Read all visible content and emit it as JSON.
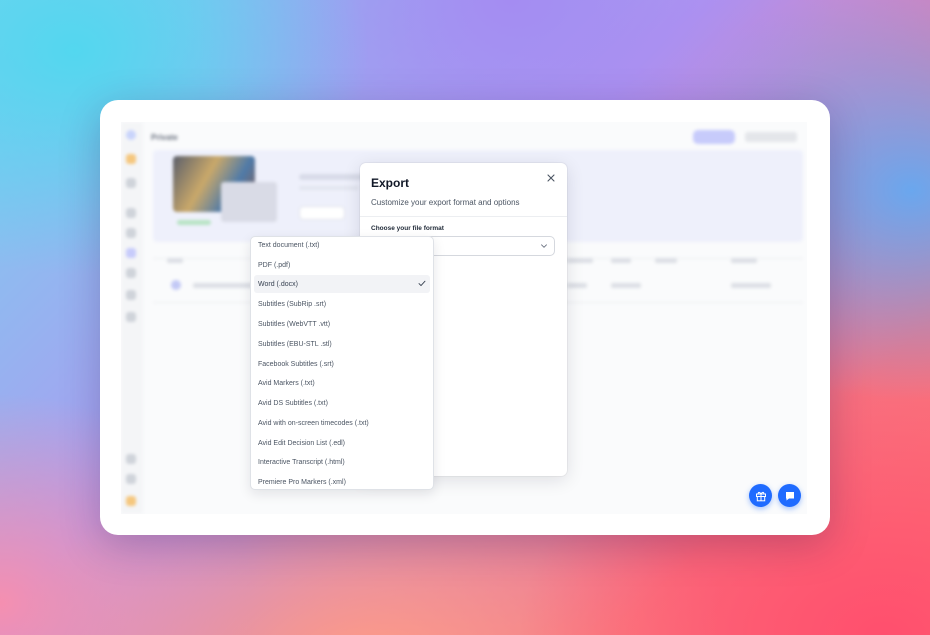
{
  "background_app": {
    "page_title": "Private"
  },
  "export_modal": {
    "title": "Export",
    "subtitle": "Customize your export format and options",
    "format_label": "Choose your file format",
    "selected_format": "Word (.docx)",
    "close_icon": "close-icon",
    "options": [
      {
        "label": "Text document (.txt)",
        "selected": false
      },
      {
        "label": "PDF (.pdf)",
        "selected": false
      },
      {
        "label": "Word (.docx)",
        "selected": true
      },
      {
        "label": "Subtitles (SubRip .srt)",
        "selected": false
      },
      {
        "label": "Subtitles (WebVTT .vtt)",
        "selected": false
      },
      {
        "label": "Subtitles (EBU-STL .stl)",
        "selected": false
      },
      {
        "label": "Facebook Subtitles (.srt)",
        "selected": false
      },
      {
        "label": "Avid Markers (.txt)",
        "selected": false
      },
      {
        "label": "Avid DS Subtitles (.txt)",
        "selected": false
      },
      {
        "label": "Avid with on-screen timecodes (.txt)",
        "selected": false
      },
      {
        "label": "Avid Edit Decision List (.edl)",
        "selected": false
      },
      {
        "label": "Interactive Transcript (.html)",
        "selected": false
      },
      {
        "label": "Premiere Pro Markers (.xml)",
        "selected": false
      }
    ]
  },
  "floating_buttons": {
    "gift_icon": "gift-icon",
    "chat_icon": "chat-icon"
  },
  "colors": {
    "accent": "#1f6bff",
    "selected_row": "#f2f3f6"
  }
}
